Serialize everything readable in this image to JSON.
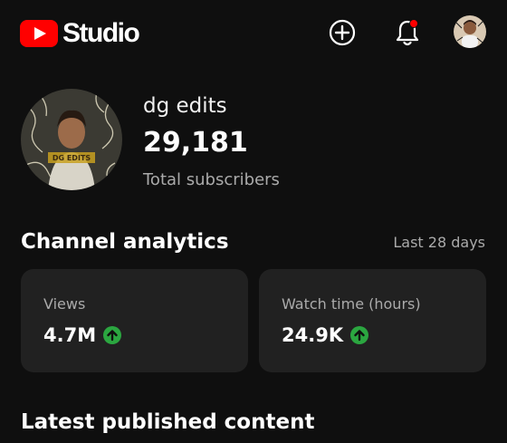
{
  "header": {
    "logo_text": "Studio",
    "brand_color": "#ff0000",
    "icons": [
      "create-icon",
      "bell-icon",
      "account-avatar"
    ],
    "notification_dot_color": "#ff0000"
  },
  "channel": {
    "name": "dg edits",
    "subscriber_count": "29,181",
    "subscriber_label": "Total subscribers",
    "avatar_text": "DG EDITS"
  },
  "analytics": {
    "title": "Channel analytics",
    "period": "Last 28 days",
    "metrics": [
      {
        "label": "Views",
        "value": "4.7M",
        "trend": "up"
      },
      {
        "label": "Watch time (hours)",
        "value": "24.9K",
        "trend": "up"
      }
    ],
    "trend_up_color": "#2ba640"
  },
  "latest": {
    "title": "Latest published content"
  }
}
